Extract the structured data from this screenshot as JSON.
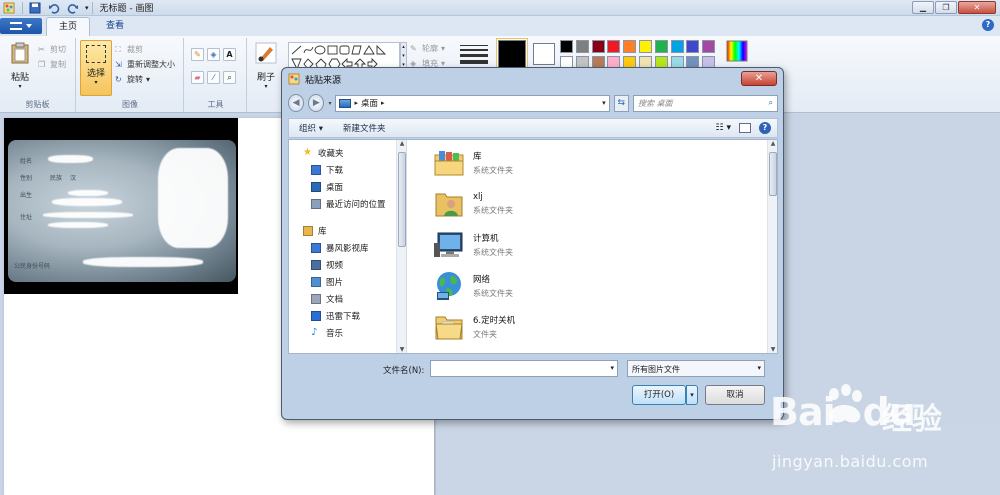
{
  "window": {
    "title": "无标题 - 画图"
  },
  "tabs": [
    {
      "label": "主页"
    },
    {
      "label": "查看"
    }
  ],
  "ribbon": {
    "clipboard": {
      "label": "剪贴板",
      "paste": "粘贴",
      "cut": "剪切",
      "copy": "复制"
    },
    "image": {
      "label": "图像",
      "select": "选择",
      "crop": "裁剪",
      "resize": "重新调整大小",
      "rotate": "旋转"
    },
    "tools": {
      "label": "工具"
    },
    "brush": {
      "label": "刷子"
    },
    "shapes": {
      "outline": "轮廓",
      "fill": "填充"
    }
  },
  "palette": {
    "color1": "#000000",
    "color2": "#ffffff",
    "row1": [
      "#000000",
      "#7f7f7f",
      "#880015",
      "#ed1c24",
      "#ff7f27",
      "#fff200",
      "#22b14c",
      "#00a2e8",
      "#3f48cc",
      "#a349a4"
    ],
    "row2": [
      "#ffffff",
      "#c3c3c3",
      "#b97a57",
      "#ffaec9",
      "#ffc90e",
      "#efe4b0",
      "#b5e61d",
      "#99d9ea",
      "#7092be",
      "#c8bfe7"
    ]
  },
  "idcard": {
    "fields": [
      "姓名",
      "性别",
      "民族",
      "汉",
      "出生",
      "住址"
    ],
    "number_label": "公民身份号码"
  },
  "dialog": {
    "title": "粘贴来源",
    "address": "桌面",
    "search_placeholder": "搜索 桌面",
    "organize": "组织 ▾",
    "new_folder": "新建文件夹",
    "nav": [
      {
        "label": "收藏夹",
        "icon": "star-icon",
        "head": true
      },
      {
        "label": "下载",
        "icon": "downloads-folder-icon"
      },
      {
        "label": "桌面",
        "icon": "desktop-icon"
      },
      {
        "label": "最近访问的位置",
        "icon": "recent-places-icon"
      },
      {
        "label": "库",
        "icon": "libraries-icon",
        "head": true
      },
      {
        "label": "暴风影视库",
        "icon": "video-library-icon"
      },
      {
        "label": "视频",
        "icon": "videos-icon"
      },
      {
        "label": "图片",
        "icon": "pictures-icon"
      },
      {
        "label": "文档",
        "icon": "documents-icon"
      },
      {
        "label": "迅雷下载",
        "icon": "thunder-download-icon"
      },
      {
        "label": "音乐",
        "icon": "music-icon"
      }
    ],
    "files": [
      {
        "name": "库",
        "type": "系统文件夹",
        "icon": "libraries-folder-icon"
      },
      {
        "name": "xlj",
        "type": "系统文件夹",
        "icon": "user-folder-icon"
      },
      {
        "name": "计算机",
        "type": "系统文件夹",
        "icon": "computer-icon"
      },
      {
        "name": "网络",
        "type": "系统文件夹",
        "icon": "network-icon"
      },
      {
        "name": "6.定时关机",
        "type": "文件夹",
        "icon": "folder-icon"
      }
    ],
    "filename_label": "文件名(N):",
    "filename_value": "",
    "filetype": "所有图片文件",
    "open": "打开(O)",
    "cancel": "取消"
  },
  "watermark": {
    "logo": "Bai",
    "logo2": "du",
    "cn": "经验",
    "url": "jingyan.baidu.com"
  }
}
